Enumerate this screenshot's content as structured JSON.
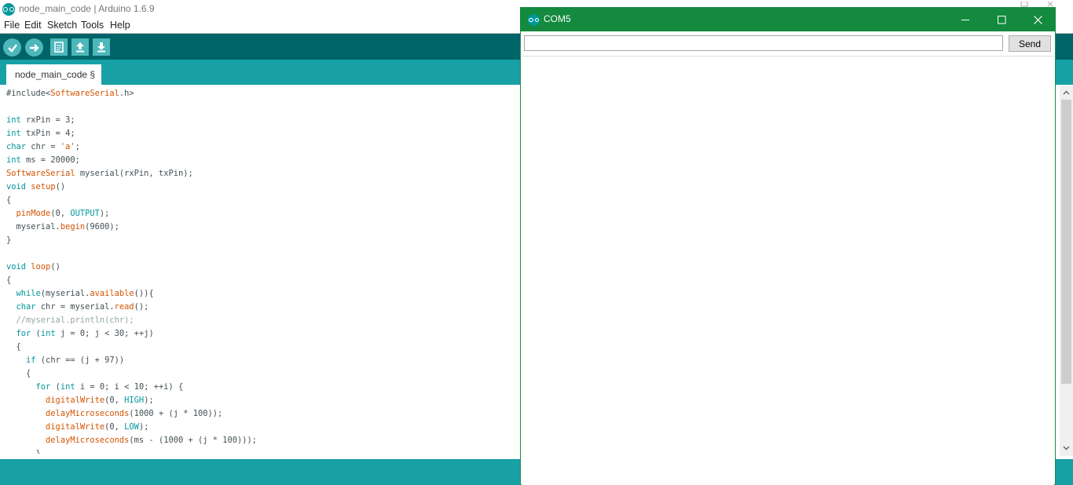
{
  "ide": {
    "title": "node_main_code | Arduino 1.6.9"
  },
  "menu": {
    "file": "File",
    "edit": "Edit",
    "sketch": "Sketch",
    "tools": "Tools",
    "help": "Help"
  },
  "toolbar": {
    "icons": [
      "verify-icon",
      "upload-icon",
      "new-icon",
      "open-icon",
      "save-icon"
    ]
  },
  "tab": {
    "label": "node_main_code §"
  },
  "code": {
    "lines": [
      "#include<SoftwareSerial.h>",
      "",
      "int rxPin = 3;",
      "int txPin = 4;",
      "char chr = 'a';",
      "int ms = 20000;",
      "SoftwareSerial myserial(rxPin, txPin);",
      "void setup()",
      "{",
      "  pinMode(0, OUTPUT);",
      "  myserial.begin(9600);",
      "}",
      "",
      "void loop()",
      "{",
      "  while(myserial.available()){",
      "  char chr = myserial.read();",
      "  //myserial.println(chr);",
      "  for (int j = 0; j < 30; ++j)",
      "  {",
      "    if (chr == (j + 97))",
      "    {",
      "      for (int i = 0; i < 10; ++i) {",
      "        digitalWrite(0, HIGH);",
      "        delayMicroseconds(1000 + (j * 100));",
      "        digitalWrite(0, LOW);",
      "        delayMicroseconds(ms - (1000 + (j * 100)));",
      "      }"
    ]
  },
  "serial_monitor": {
    "title": "COM5",
    "input_value": "",
    "send_label": "Send"
  },
  "colors": {
    "teal_dark": "#006468",
    "teal": "#17a1a5",
    "serial_title_green": "#138a3e",
    "keyword": "#00979c",
    "function": "#d35400"
  }
}
